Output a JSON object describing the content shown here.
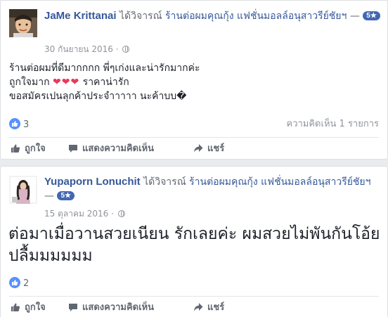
{
  "posts": [
    {
      "author": "JaMe Krittanai",
      "verb": "ได้วิจารณ์",
      "page": "ร้านต่อผมคุณกุ้ง แฟชั่นมอลล์อนุสาวรีย์ชัยฯ",
      "badge": "5★",
      "dash": "—",
      "time": "30 กันยายน 2016 ·",
      "text_lines": [
        "ร้านต่อผมที่ดีมากกกก พี่ๆเก่งและน่ารักมากค่ะ",
        "ถูกใจมาก",
        "ราคาน่ารัก",
        "ขอสมัครเปนลุกค้าประจำาาาา นะค้าบบ�"
      ],
      "hearts": "❤❤❤",
      "reactions_count": "3",
      "comments_count": "ความคิดเห็น 1 รายการ",
      "actions": {
        "like": "ถูกใจ",
        "comment": "แสดงความคิดเห็น",
        "share": "แชร์"
      }
    },
    {
      "author": "Yupaporn Lonuchit",
      "verb": "ได้วิจารณ์",
      "page": "ร้านต่อผมคุณกุ้ง แฟชั่นมอลล์อนุสาวรีย์ชัยฯ",
      "badge": "5★",
      "dash": "—",
      "time": "15 ตุลาคม 2016 ·",
      "text": "ต่อมาเมื่อวานสวยเนียน รักเลยค่ะ ผมสวยไม่พันกันโอ้ยปลื้มมมมมม",
      "reactions_count": "2",
      "actions": {
        "like": "ถูกใจ",
        "comment": "แสดงความคิดเห็น",
        "share": "แชร์"
      }
    }
  ],
  "colors": {
    "link": "#365899",
    "like_blue": "#5890ff",
    "heart": "#e8395a",
    "muted": "#90949c"
  }
}
